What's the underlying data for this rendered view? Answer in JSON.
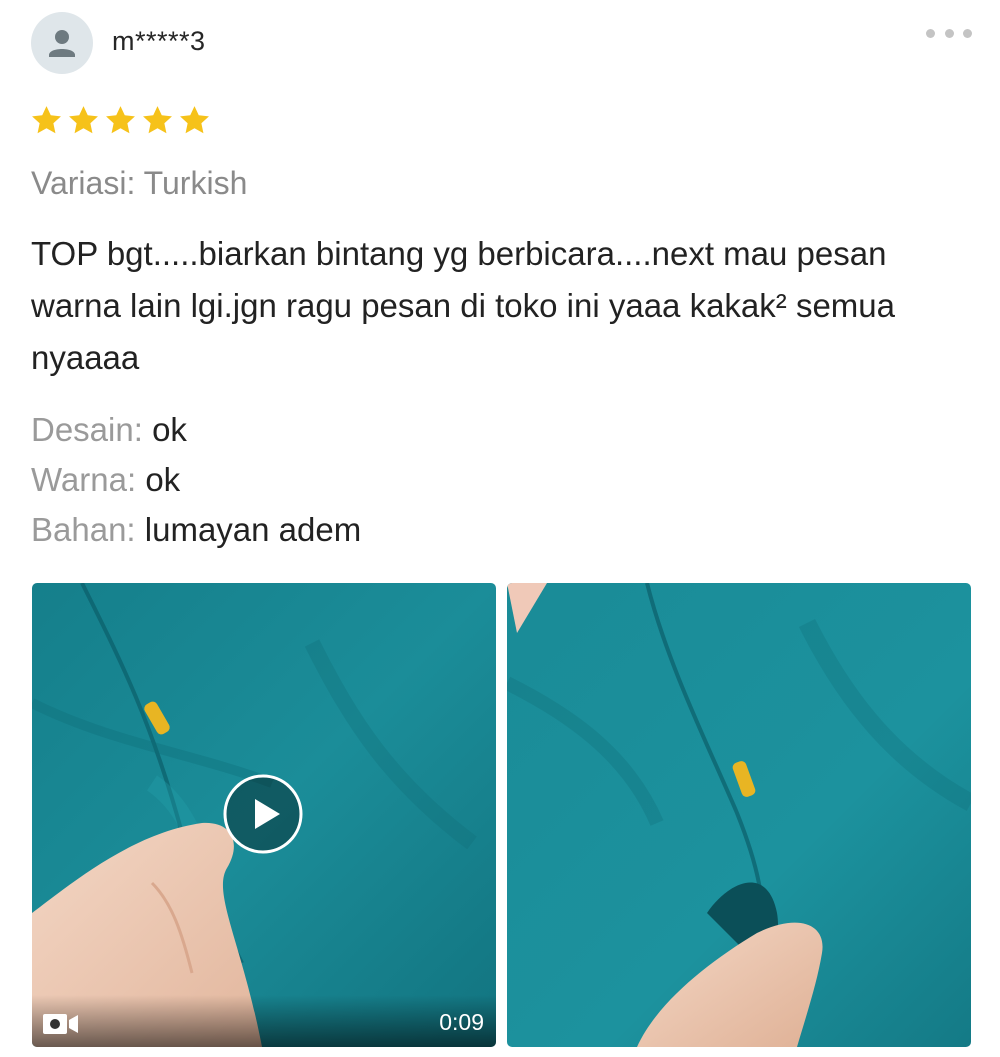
{
  "review": {
    "username": "m*****3",
    "rating": 5,
    "rating_max": 5,
    "star_color": "#f6c21a",
    "variation": "Variasi: Turkish",
    "text": "TOP bgt.....biarkan bintang yg berbicara....next mau pesan warna lain lgi.jgn ragu pesan di toko ini yaaa kakak² semua nyaaaa",
    "attributes": [
      {
        "label": "Desain:",
        "value": "ok"
      },
      {
        "label": "Warna:",
        "value": "ok"
      },
      {
        "label": "Bahan:",
        "value": "lumayan adem"
      }
    ],
    "media": {
      "video_duration": "0:09"
    }
  },
  "icons": {
    "avatar": "person-icon",
    "more": "more-icon",
    "play": "play-icon",
    "video": "video-camera-icon"
  },
  "colors": {
    "fabric": "#1a8a95",
    "avatar_bg": "#dfe6ea"
  }
}
